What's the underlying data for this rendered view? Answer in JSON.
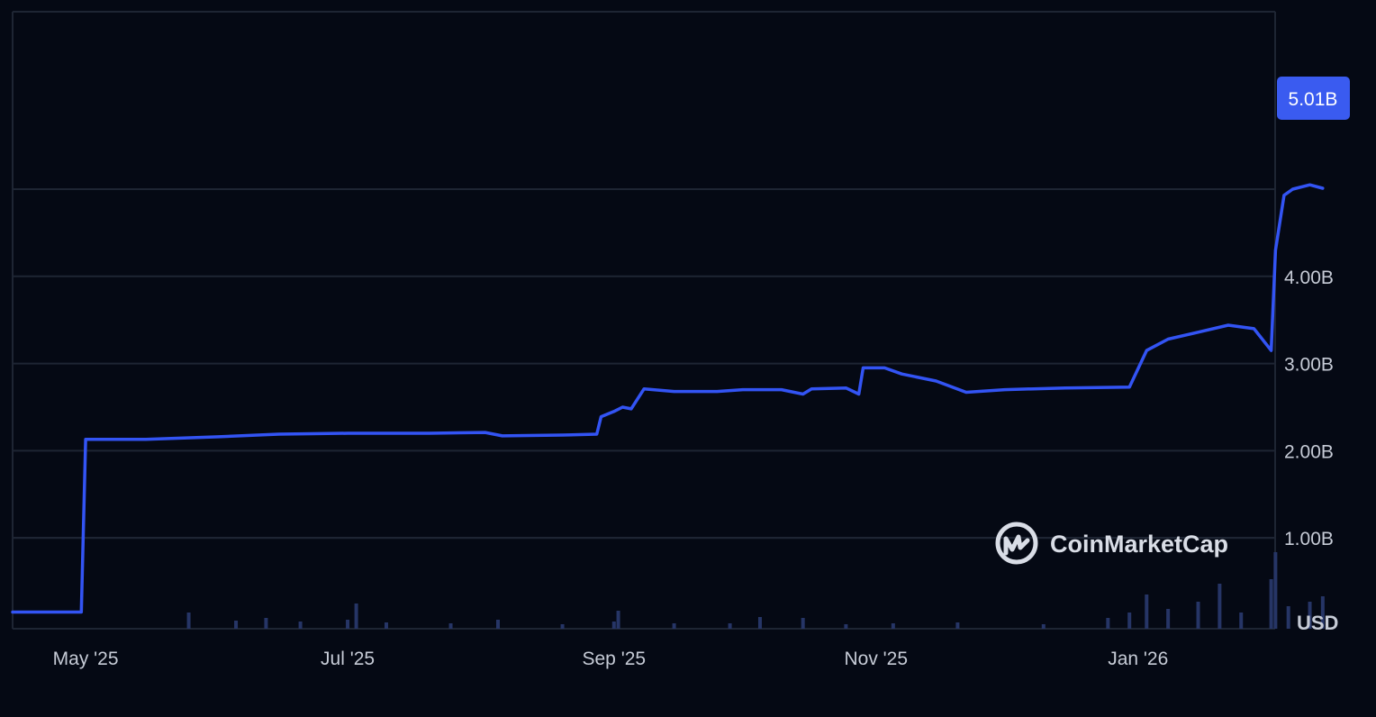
{
  "chart_data": {
    "type": "line",
    "currency_label": "USD",
    "watermark": "CoinMarketCap",
    "current_value_label": "5.01B",
    "y_ticks": [
      {
        "value": 1000000000,
        "label": "1.00B"
      },
      {
        "value": 2000000000,
        "label": "2.00B"
      },
      {
        "value": 3000000000,
        "label": "3.00B"
      },
      {
        "value": 4000000000,
        "label": "4.00B"
      }
    ],
    "x_ticks": [
      {
        "date": "2025-05-01",
        "label": "May '25"
      },
      {
        "date": "2025-07-01",
        "label": "Jul '25"
      },
      {
        "date": "2025-09-01",
        "label": "Sep '25"
      },
      {
        "date": "2025-11-01",
        "label": "Nov '25"
      },
      {
        "date": "2026-01-01",
        "label": "Jan '26"
      }
    ],
    "colors": {
      "background": "#050914",
      "line": "#3354f4",
      "gridline": "#1e2533",
      "volume": "#263566",
      "badge": "#3a5bf0"
    },
    "series": [
      {
        "values": [
          [
            "2025-04-14",
            150000000.0
          ],
          [
            "2025-04-30",
            150000000.0
          ],
          [
            "2025-05-01",
            2130000000.0
          ],
          [
            "2025-05-15",
            2130000000.0
          ],
          [
            "2025-06-01",
            2160000000.0
          ],
          [
            "2025-06-15",
            2190000000.0
          ],
          [
            "2025-07-01",
            2200000000.0
          ],
          [
            "2025-07-20",
            2200000000.0
          ],
          [
            "2025-08-02",
            2210000000.0
          ],
          [
            "2025-08-06",
            2170000000.0
          ],
          [
            "2025-08-20",
            2180000000.0
          ],
          [
            "2025-08-28",
            2190000000.0
          ],
          [
            "2025-08-29",
            2390000000.0
          ],
          [
            "2025-09-01",
            2450000000.0
          ],
          [
            "2025-09-03",
            2500000000.0
          ],
          [
            "2025-09-05",
            2480000000.0
          ],
          [
            "2025-09-08",
            2710000000.0
          ],
          [
            "2025-09-15",
            2680000000.0
          ],
          [
            "2025-09-25",
            2680000000.0
          ],
          [
            "2025-10-01",
            2700000000.0
          ],
          [
            "2025-10-10",
            2700000000.0
          ],
          [
            "2025-10-15",
            2650000000.0
          ],
          [
            "2025-10-17",
            2710000000.0
          ],
          [
            "2025-10-25",
            2720000000.0
          ],
          [
            "2025-10-28",
            2650000000.0
          ],
          [
            "2025-10-29",
            2950000000.0
          ],
          [
            "2025-11-03",
            2950000000.0
          ],
          [
            "2025-11-07",
            2880000000.0
          ],
          [
            "2025-11-15",
            2800000000.0
          ],
          [
            "2025-11-22",
            2670000000.0
          ],
          [
            "2025-12-01",
            2700000000.0
          ],
          [
            "2025-12-15",
            2720000000.0
          ],
          [
            "2025-12-30",
            2730000000.0
          ],
          [
            "2026-01-03",
            3150000000.0
          ],
          [
            "2026-01-08",
            3280000000.0
          ],
          [
            "2026-01-15",
            3360000000.0
          ],
          [
            "2026-01-22",
            3440000000.0
          ],
          [
            "2026-01-28",
            3400000000.0
          ],
          [
            "2026-02-01",
            3150000000.0
          ],
          [
            "2026-02-02",
            4300000000.0
          ],
          [
            "2026-02-04",
            4930000000.0
          ],
          [
            "2026-02-06",
            5000000000.0
          ],
          [
            "2026-02-10",
            5050000000.0
          ],
          [
            "2026-02-13",
            5010000000.0
          ]
        ]
      }
    ],
    "volume": [
      [
        "2025-05-25",
        18
      ],
      [
        "2025-06-05",
        9
      ],
      [
        "2025-06-12",
        12
      ],
      [
        "2025-06-20",
        8
      ],
      [
        "2025-07-01",
        10
      ],
      [
        "2025-07-03",
        28
      ],
      [
        "2025-07-10",
        7
      ],
      [
        "2025-07-25",
        6
      ],
      [
        "2025-08-05",
        10
      ],
      [
        "2025-08-20",
        5
      ],
      [
        "2025-09-01",
        8
      ],
      [
        "2025-09-02",
        20
      ],
      [
        "2025-09-15",
        6
      ],
      [
        "2025-09-28",
        6
      ],
      [
        "2025-10-05",
        13
      ],
      [
        "2025-10-15",
        12
      ],
      [
        "2025-10-25",
        5
      ],
      [
        "2025-11-05",
        6
      ],
      [
        "2025-11-20",
        7
      ],
      [
        "2025-12-10",
        5
      ],
      [
        "2025-12-25",
        12
      ],
      [
        "2025-12-30",
        18
      ],
      [
        "2026-01-03",
        38
      ],
      [
        "2026-01-08",
        22
      ],
      [
        "2026-01-15",
        30
      ],
      [
        "2026-01-20",
        50
      ],
      [
        "2026-01-25",
        18
      ],
      [
        "2026-02-01",
        55
      ],
      [
        "2026-02-02",
        85
      ],
      [
        "2026-02-05",
        25
      ],
      [
        "2026-02-10",
        30
      ],
      [
        "2026-02-13",
        36
      ]
    ]
  }
}
